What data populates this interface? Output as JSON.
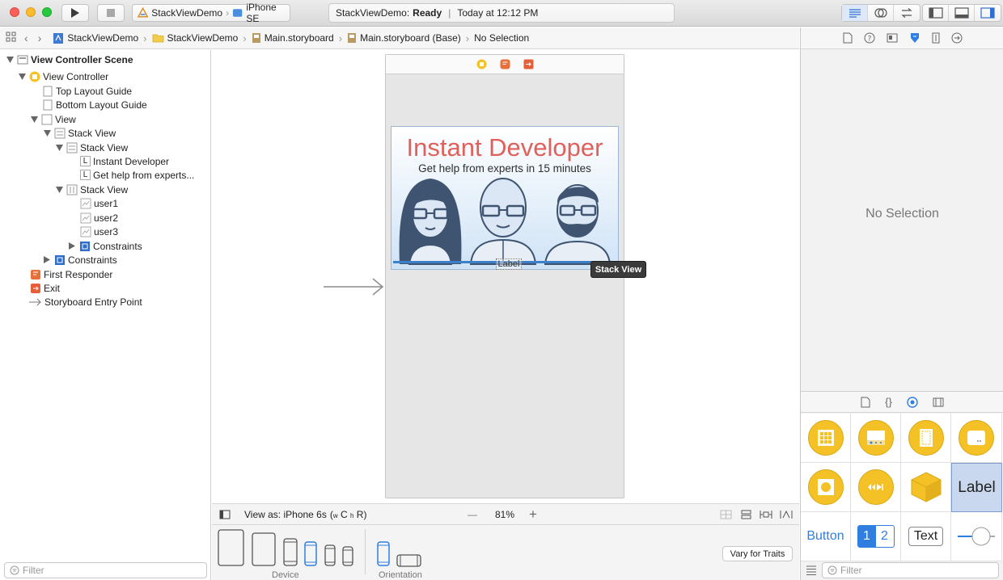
{
  "toolbar": {
    "scheme_project": "StackViewDemo",
    "scheme_device": "iPhone SE",
    "status_project": "StackViewDemo:",
    "status_state": "Ready",
    "status_divider": "|",
    "status_time": "Today at 12:12 PM"
  },
  "jumpbar": {
    "crumbs": [
      "StackViewDemo",
      "StackViewDemo",
      "Main.storyboard",
      "Main.storyboard (Base)",
      "No Selection"
    ]
  },
  "outline": {
    "items": [
      {
        "label": "View Controller Scene",
        "icon": "scene-icon"
      },
      {
        "label": "View Controller",
        "icon": "view-controller-icon"
      },
      {
        "label": "Top Layout Guide",
        "icon": "layout-guide-icon"
      },
      {
        "label": "Bottom Layout Guide",
        "icon": "layout-guide-icon"
      },
      {
        "label": "View",
        "icon": "view-icon"
      },
      {
        "label": "Stack View",
        "icon": "vertical-stack-icon"
      },
      {
        "label": "Stack View",
        "icon": "vertical-stack-icon"
      },
      {
        "label": "Instant Developer",
        "icon": "label-icon",
        "glyph": "L"
      },
      {
        "label": "Get help from experts...",
        "icon": "label-icon",
        "glyph": "L"
      },
      {
        "label": "Stack View",
        "icon": "horizontal-stack-icon"
      },
      {
        "label": "user1",
        "icon": "image-view-icon"
      },
      {
        "label": "user2",
        "icon": "image-view-icon"
      },
      {
        "label": "user3",
        "icon": "image-view-icon"
      },
      {
        "label": "Constraints",
        "icon": "constraints-icon"
      },
      {
        "label": "Constraints",
        "icon": "constraints-icon"
      },
      {
        "label": "First Responder",
        "icon": "first-responder-icon"
      },
      {
        "label": "Exit",
        "icon": "exit-icon"
      },
      {
        "label": "Storyboard Entry Point",
        "icon": "entry-arrow-icon"
      }
    ],
    "filter_placeholder": "Filter"
  },
  "canvas": {
    "headline": "Instant Developer",
    "subtitle": "Get help from experts in 15 minutes",
    "label_placeholder": "Label",
    "tooltip": "Stack View",
    "colors": {
      "headline": "#e0615c",
      "selection": "#3d7fc9"
    }
  },
  "bottombar": {
    "view_as": "View as: iPhone 6s",
    "size_class_w": "w",
    "size_class_c": "C",
    "size_class_h": "h",
    "size_class_r": "R",
    "zoom_minus": "—",
    "zoom": "81%",
    "zoom_plus": "+",
    "device_label": "Device",
    "orientation_label": "Orientation",
    "vary_button": "Vary for Traits"
  },
  "inspector": {
    "no_selection": "No Selection",
    "library": {
      "label_tile": "Label",
      "button_tile": "Button",
      "segment_1": "1",
      "segment_2": "2",
      "text_tile": "Text"
    },
    "filter_placeholder": "Filter"
  }
}
